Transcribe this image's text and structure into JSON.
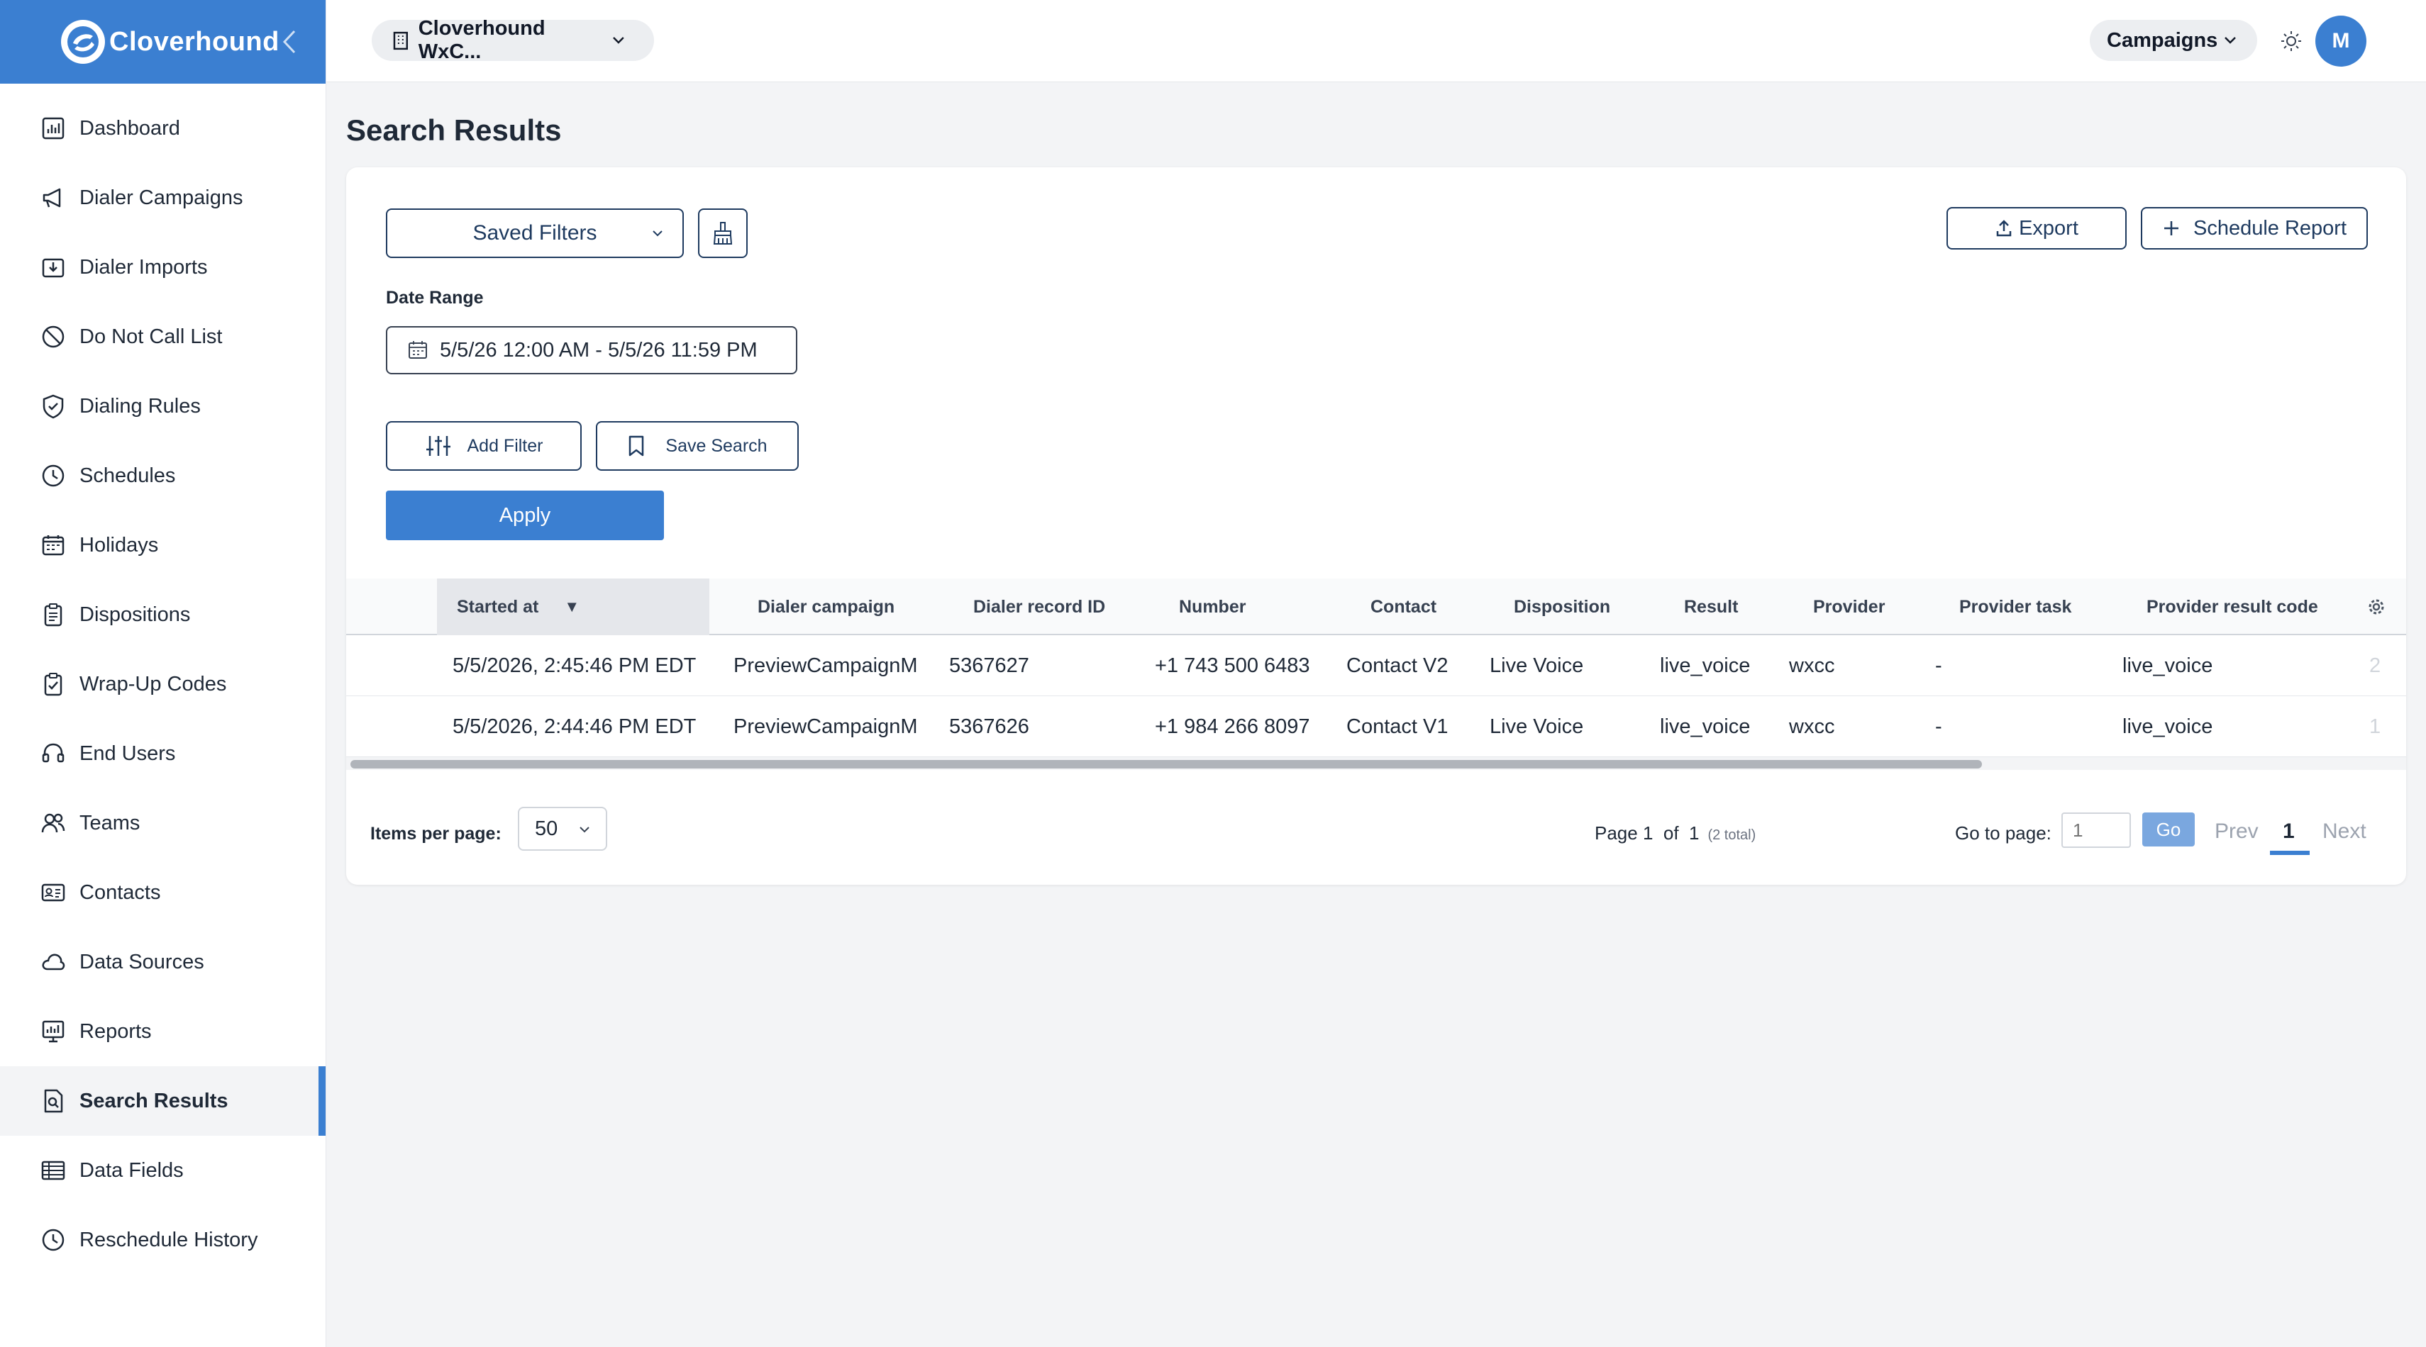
{
  "brand": {
    "name": "Cloverhound"
  },
  "nav": {
    "items": [
      {
        "label": "Dashboard",
        "icon": "dashboard-icon"
      },
      {
        "label": "Dialer Campaigns",
        "icon": "megaphone-icon"
      },
      {
        "label": "Dialer Imports",
        "icon": "import-icon"
      },
      {
        "label": "Do Not Call List",
        "icon": "block-icon"
      },
      {
        "label": "Dialing Rules",
        "icon": "shield-icon"
      },
      {
        "label": "Schedules",
        "icon": "clock-icon"
      },
      {
        "label": "Holidays",
        "icon": "calendar-icon"
      },
      {
        "label": "Dispositions",
        "icon": "clipboard-icon"
      },
      {
        "label": "Wrap-Up Codes",
        "icon": "clipboard-check-icon"
      },
      {
        "label": "End Users",
        "icon": "headset-icon"
      },
      {
        "label": "Teams",
        "icon": "users-icon"
      },
      {
        "label": "Contacts",
        "icon": "contact-card-icon"
      },
      {
        "label": "Data Sources",
        "icon": "cloud-icon"
      },
      {
        "label": "Reports",
        "icon": "report-icon"
      },
      {
        "label": "Search Results",
        "icon": "search-document-icon"
      },
      {
        "label": "Data Fields",
        "icon": "table-icon"
      },
      {
        "label": "Reschedule History",
        "icon": "history-icon"
      }
    ],
    "active": "Search Results"
  },
  "topbar": {
    "org": "Cloverhound WxC...",
    "campaigns": "Campaigns",
    "avatar": "M"
  },
  "page": {
    "title": "Search Results"
  },
  "filters": {
    "saved_filters": "Saved Filters",
    "export": "Export",
    "schedule_report": "Schedule Report",
    "date_label": "Date Range",
    "date_value": "5/5/26 12:00 AM - 5/5/26 11:59 PM",
    "add_filter": "Add Filter",
    "save_search": "Save Search",
    "apply": "Apply"
  },
  "table": {
    "columns": [
      "Started at",
      "Dialer campaign",
      "Dialer record ID",
      "Number",
      "Contact",
      "Disposition",
      "Result",
      "Provider",
      "Provider task",
      "Provider result code"
    ],
    "sort_indicator": "▼",
    "rows": [
      [
        "5/5/2026, 2:45:46 PM EDT",
        "PreviewCampaignM",
        "5367627",
        "+1 743 500 6483",
        "Contact V2",
        "Live Voice",
        "live_voice",
        "wxcc",
        "-",
        "live_voice",
        "2"
      ],
      [
        "5/5/2026, 2:44:46 PM EDT",
        "PreviewCampaignM",
        "5367626",
        "+1 984 266 8097",
        "Contact V1",
        "Live Voice",
        "live_voice",
        "wxcc",
        "-",
        "live_voice",
        "1"
      ]
    ]
  },
  "pagination": {
    "items_per_page_label": "Items per page:",
    "items_per_page": "50",
    "page_text": "Page 1  of  1",
    "total_text": "(2 total)",
    "goto_label": "Go to page:",
    "goto_value": "1",
    "go": "Go",
    "prev": "Prev",
    "current": "1",
    "next": "Next"
  },
  "colors": {
    "accent": "#3b7fd1",
    "dark_outline": "#1e3a5f"
  }
}
